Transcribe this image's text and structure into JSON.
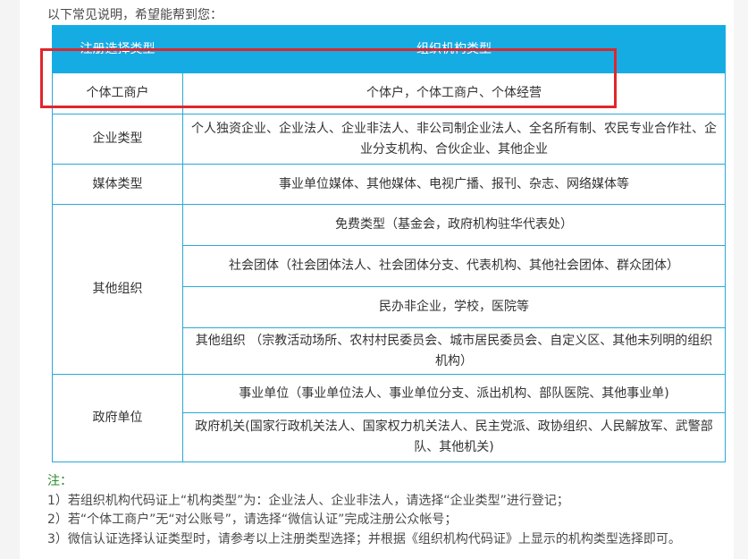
{
  "intro": "以下常见说明，希望能帮到您：",
  "table": {
    "headers": [
      "注册选择类型",
      "组织机构类型"
    ],
    "rows": [
      {
        "type": "个体工商户",
        "items": [
          "个体户，个体工商户、个体经营"
        ]
      },
      {
        "type": "企业类型",
        "items": [
          "个人独资企业、企业法人、企业非法人、非公司制企业法人、全名所有制、农民专业合作社、企业分支机构、合伙企业、其他企业"
        ]
      },
      {
        "type": "媒体类型",
        "items": [
          "事业单位媒体、其他媒体、电视广播、报刊、杂志、网络媒体等"
        ]
      },
      {
        "type": "其他组织",
        "items": [
          "免费类型（基金会，政府机构驻华代表处）",
          "社会团体（社会团体法人、社会团体分支、代表机构、其他社会团体、群众团体）",
          "民办非企业，学校，医院等",
          "其他组织 （宗教活动场所、农村村民委员会、城市居民委员会、自定义区、其他未列明的组织机构）"
        ]
      },
      {
        "type": "政府单位",
        "items": [
          "事业单位（事业单位法人、事业单位分支、派出机构、部队医院、其他事业单)",
          "政府机关(国家行政机关法人、国家权力机关法人、民主党派、政协组织、人民解放军、武警部队、其他机关)"
        ]
      }
    ]
  },
  "notes": {
    "title": "注：",
    "lines": [
      "1）若组织机构代码证上“机构类型”为：企业法人、企业非法人，请选择“企业类型”进行登记；",
      "2）若“个体工商户”无“对公账号”，请选择“微信认证”完成注册公众帐号；",
      "3）微信认证选择认证类型时，请参考以上注册类型选择；并根据《组织机构代码证》上显示的机构类型选择即可。"
    ]
  },
  "colors": {
    "header_bg": "#15ace4",
    "border": "#2aa9d8",
    "highlight": "#e0262c",
    "note_title": "#2a8a2a"
  }
}
